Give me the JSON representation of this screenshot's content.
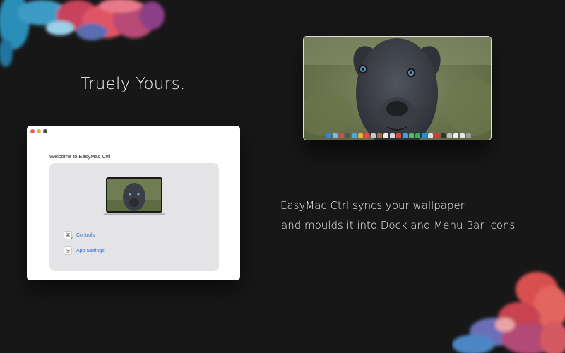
{
  "headline": "Truely Yours.",
  "app_window": {
    "welcome": "Welcome to EasyMac Ctrl",
    "options": [
      {
        "label": "Controls",
        "icon": "command-key-icon"
      },
      {
        "label": "App Settings",
        "icon": "aperture-icon"
      }
    ]
  },
  "tagline": {
    "line1": "EasyMac Ctrl syncs your wallpaper",
    "line2": "and moulds it into Dock and Menu Bar Icons"
  },
  "colors": {
    "background": "#171717",
    "link": "#2f6fd6",
    "close": "#ee5b52",
    "minimize": "#e6b431"
  }
}
